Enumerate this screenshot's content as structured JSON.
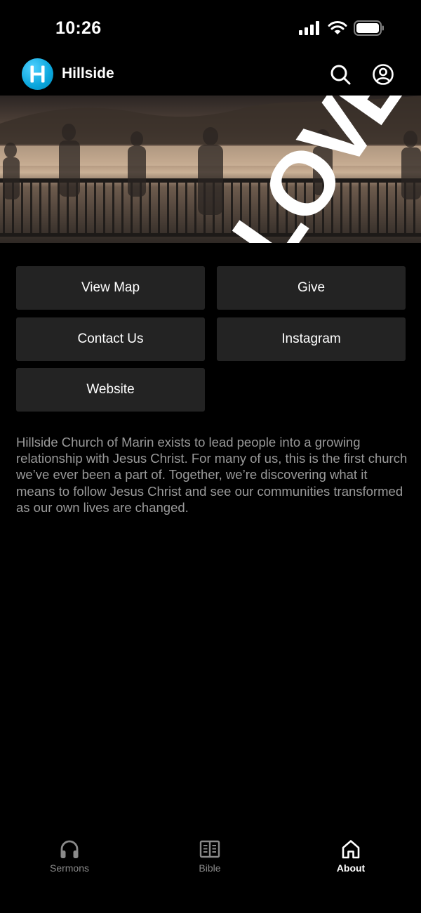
{
  "status_bar": {
    "time": "10:26",
    "icons": [
      "cellular-signal-icon",
      "wifi-icon",
      "battery-icon"
    ]
  },
  "header": {
    "logo_letter": "H",
    "title": "Hillside",
    "icons": [
      "search-icon",
      "account-icon"
    ],
    "accent_color": "#12a9e0"
  },
  "hero": {
    "overlay_text": "LOVE"
  },
  "buttons": {
    "view_map": "View Map",
    "give": "Give",
    "contact_us": "Contact Us",
    "instagram": "Instagram",
    "website": "Website"
  },
  "about_text": "Hillside Church of Marin exists to lead people into a growing relationship with Jesus Christ. For many of us, this is the first church we’ve ever been a part of. Together, we’re discovering what it means to follow Jesus Christ and see our communities transformed as our own lives are changed.",
  "tabs": [
    {
      "label": "Sermons",
      "icon": "headphones-icon",
      "active": false
    },
    {
      "label": "Bible",
      "icon": "open-book-icon",
      "active": false
    },
    {
      "label": "About",
      "icon": "home-icon",
      "active": true
    }
  ]
}
